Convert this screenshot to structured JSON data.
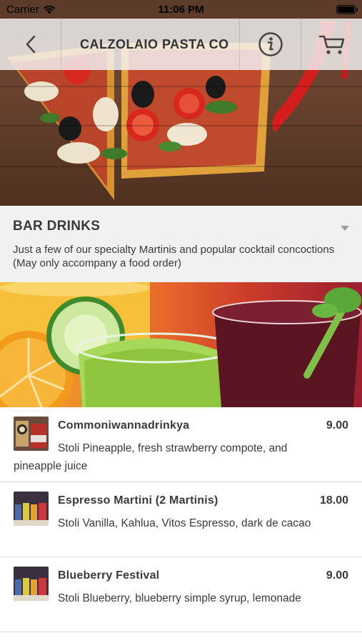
{
  "status_bar": {
    "carrier": "Carrier",
    "time": "11:06 PM"
  },
  "nav": {
    "title": "CALZOLAIO PASTA CO",
    "back_icon": "chevron-left-icon",
    "info_icon": "info-icon",
    "cart_icon": "cart-icon"
  },
  "category": {
    "title": "BAR DRINKS",
    "description": "Just a few of our specialty Martinis and popular cocktail concoctions (May only accompany a food order)"
  },
  "items": [
    {
      "name": "Commoniwannadrinkya",
      "price": "9.00",
      "description": "Stoli Pineapple, fresh strawberry compote, and pineapple juice"
    },
    {
      "name": "Espresso Martini (2 Martinis)",
      "price": "18.00",
      "description": "Stoli Vanilla, Kahlua, Vitos Espresso, dark de cacao"
    },
    {
      "name": "Blueberry Festival",
      "price": "9.00",
      "description": "Stoli Blueberry, blueberry simple syrup, lemonade"
    }
  ],
  "colors": {
    "navbar_bg": "#f5f5f5",
    "category_bg": "#f1f1f1",
    "text": "#3a3a3a",
    "divider": "#dcdcdc"
  }
}
